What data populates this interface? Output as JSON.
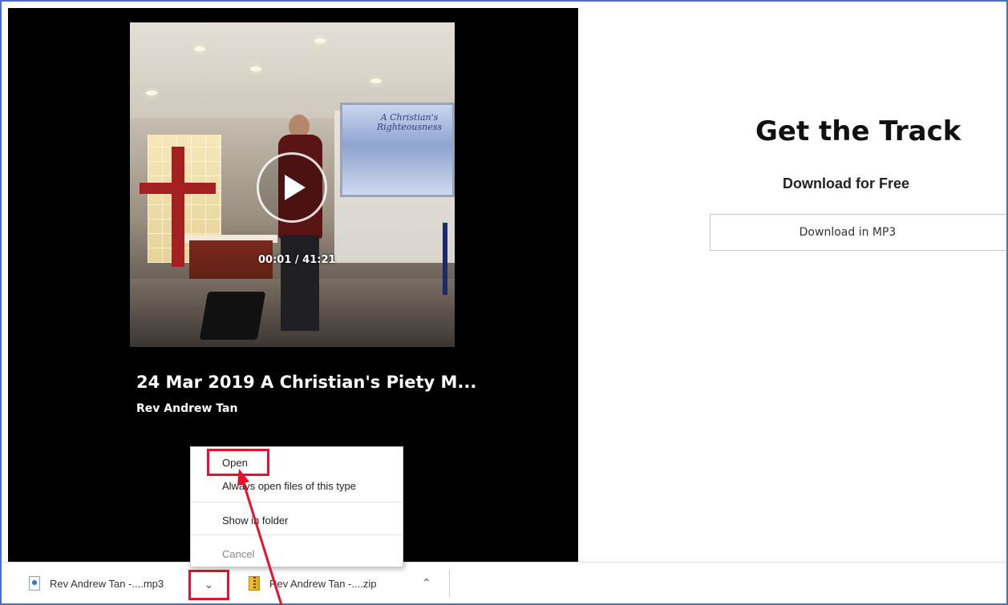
{
  "player": {
    "time": "00:01 / 41:21",
    "title": "24 Mar 2019 A Christian's Piety M...",
    "artist": "Rev Andrew Tan",
    "video_screen_text": "A Christian's Righteousness"
  },
  "download_panel": {
    "heading": "Get the Track",
    "subheading": "Download for Free",
    "button_label": "Download in MP3"
  },
  "context_menu": {
    "items": [
      {
        "label": "Open"
      },
      {
        "label": "Always open files of this type"
      },
      {
        "label": "Show in folder"
      },
      {
        "label": "Cancel"
      }
    ]
  },
  "download_bar": {
    "items": [
      {
        "name": "Rev Andrew Tan -....mp3",
        "icon": "audio-file-icon"
      },
      {
        "name": "Rev Andrew Tan -....zip",
        "icon": "zip-file-icon"
      }
    ]
  },
  "colors": {
    "highlight": "#e8112d",
    "frame": "#4472c4"
  }
}
